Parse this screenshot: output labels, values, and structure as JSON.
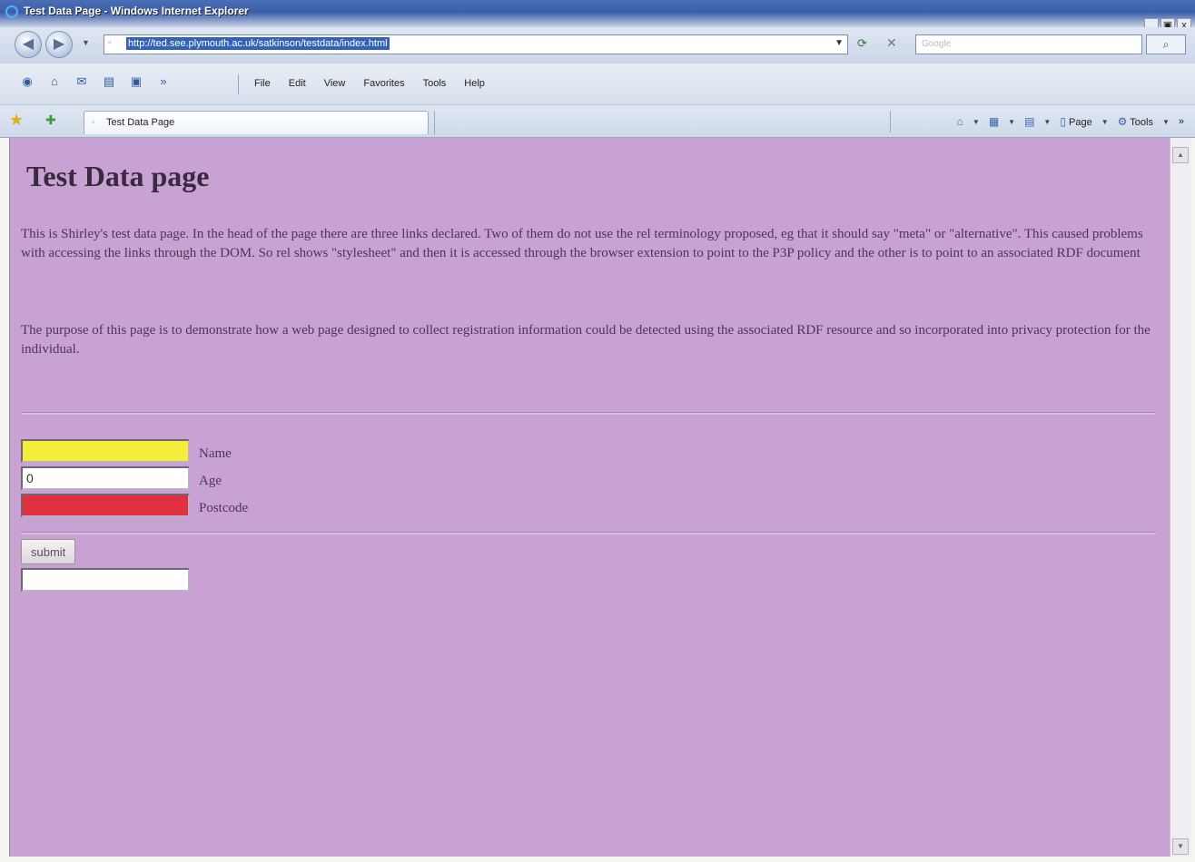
{
  "window": {
    "title": "Test Data Page - Windows Internet Explorer",
    "controls": [
      "_",
      "▣",
      "x"
    ]
  },
  "address_bar": {
    "url": "http://ted.see.plymouth.ac.uk/satkinson/testdata/index.html",
    "search_placeholder": "Google"
  },
  "menu": {
    "items": [
      "File",
      "Edit",
      "View",
      "Favorites",
      "Tools",
      "Help"
    ]
  },
  "tabs": {
    "active_label": "Test Data Page"
  },
  "command_bar": {
    "page_label": "Page",
    "tools_label": "Tools"
  },
  "page": {
    "heading": "Test Data page",
    "paragraph1": "This is Shirley's test data page. In the head of the page there are three links declared. Two of them do not use the rel terminology proposed, eg that it should say \"meta\" or \"alternative\". This caused problems with accessing the links through the DOM. So rel shows \"stylesheet\" and then it is accessed through the browser extension to point to the P3P policy and the other is to point to an associated RDF document",
    "paragraph2": "The purpose of this page is to demonstrate how a web page designed to collect registration information could be detected using the associated RDF resource and so incorporated into privacy protection for the individual.",
    "form": {
      "name_label": "Name",
      "name_value": "",
      "name_color": "#f4ee3a",
      "age_label": "Age",
      "age_value": "0",
      "postcode_label": "Postcode",
      "postcode_value": "",
      "postcode_color": "#e03040",
      "submit_label": "submit",
      "result_value": ""
    }
  },
  "colors": {
    "page_background": "#c8a2d2"
  }
}
